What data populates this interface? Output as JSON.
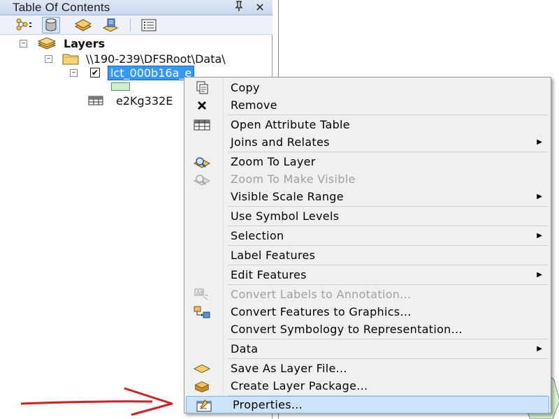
{
  "toc": {
    "title": "Table Of Contents",
    "pin_glyph": "⫯",
    "close_glyph": "✕",
    "toolbar_icons": [
      "list-by-drawing-order-icon",
      "list-by-source-icon",
      "list-by-visibility-icon",
      "list-by-selection-icon",
      "options-icon"
    ],
    "tree": {
      "root_label": "Layers",
      "folder_label": "\\\\190-239\\DFSRoot\\Data\\",
      "layer_label": "lct_000b16a_e",
      "table_label": "e2Kg332E",
      "layer_checked": "✔",
      "collapse_glyph": "−"
    }
  },
  "context_menu": {
    "items": [
      {
        "label": "Copy",
        "icon": "copy-icon",
        "enabled": true,
        "submenu": false
      },
      {
        "label": "Remove",
        "icon": "remove-icon",
        "enabled": true,
        "submenu": false
      },
      {
        "label": "Open Attribute Table",
        "icon": "attribute-table-icon",
        "enabled": true,
        "submenu": false
      },
      {
        "label": "Joins and Relates",
        "icon": "",
        "enabled": true,
        "submenu": true
      },
      {
        "label": "Zoom To Layer",
        "icon": "zoom-to-layer-icon",
        "enabled": true,
        "submenu": false
      },
      {
        "label": "Zoom To Make Visible",
        "icon": "zoom-to-make-visible-icon",
        "enabled": false,
        "submenu": false
      },
      {
        "label": "Visible Scale Range",
        "icon": "",
        "enabled": true,
        "submenu": true
      },
      {
        "label": "Use Symbol Levels",
        "icon": "",
        "enabled": true,
        "submenu": false
      },
      {
        "label": "Selection",
        "icon": "",
        "enabled": true,
        "submenu": true
      },
      {
        "label": "Label Features",
        "icon": "",
        "enabled": true,
        "submenu": false
      },
      {
        "label": "Edit Features",
        "icon": "",
        "enabled": true,
        "submenu": true
      },
      {
        "label": "Convert Labels to Annotation...",
        "icon": "convert-labels-icon",
        "enabled": false,
        "submenu": false
      },
      {
        "label": "Convert Features to Graphics...",
        "icon": "convert-features-icon",
        "enabled": true,
        "submenu": false
      },
      {
        "label": "Convert Symbology to Representation...",
        "icon": "",
        "enabled": true,
        "submenu": false
      },
      {
        "label": "Data",
        "icon": "",
        "enabled": true,
        "submenu": true
      },
      {
        "label": "Save As Layer File...",
        "icon": "layer-file-icon",
        "enabled": true,
        "submenu": false
      },
      {
        "label": "Create Layer Package...",
        "icon": "layer-package-icon",
        "enabled": true,
        "submenu": false
      },
      {
        "label": "Properties...",
        "icon": "properties-icon",
        "enabled": true,
        "submenu": false,
        "highlighted": true
      }
    ],
    "submenu_arrow": "▶"
  },
  "colors": {
    "selection": "#3399ff",
    "menu_hover": "#cbe4fb",
    "arrow": "#d22020"
  }
}
